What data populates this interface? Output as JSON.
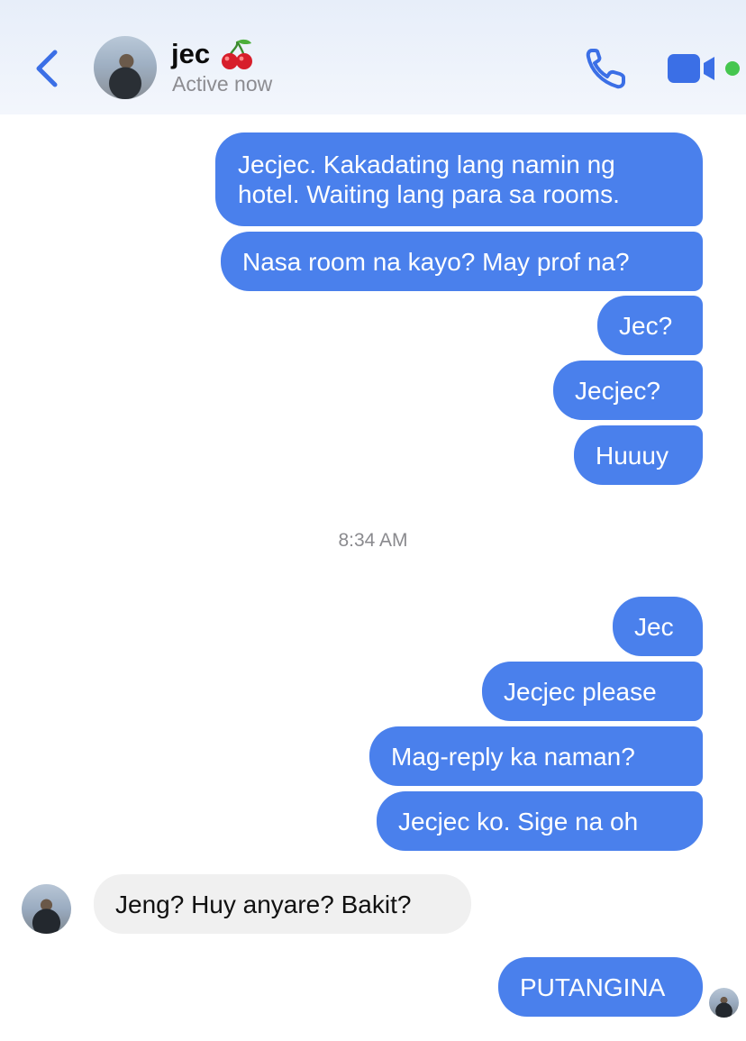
{
  "header": {
    "contact_name": "jec",
    "status": "Active now",
    "accent_color": "#3b6fe6"
  },
  "timestamp": "8:34 AM",
  "messages": [
    {
      "sender": "me",
      "text_lines": [
        "Jecjec. Kakadating lang namin ng",
        "hotel. Waiting lang para sa rooms."
      ]
    },
    {
      "sender": "me",
      "text": "Nasa room na kayo? May prof na?"
    },
    {
      "sender": "me",
      "text": "Jec?"
    },
    {
      "sender": "me",
      "text": "Jecjec?"
    },
    {
      "sender": "me",
      "text": "Huuuy"
    },
    {
      "sender": "me",
      "text": "Jec"
    },
    {
      "sender": "me",
      "text": "Jecjec please"
    },
    {
      "sender": "me",
      "text": "Mag-reply ka naman?"
    },
    {
      "sender": "me",
      "text": "Jecjec ko. Sige na oh"
    },
    {
      "sender": "jec",
      "text": "Jeng? Huy anyare? Bakit?"
    },
    {
      "sender": "me",
      "text": "PUTANGINA"
    }
  ],
  "colors": {
    "outgoing_bubble": "#4a80ec",
    "incoming_bubble": "#f0f0f0"
  }
}
